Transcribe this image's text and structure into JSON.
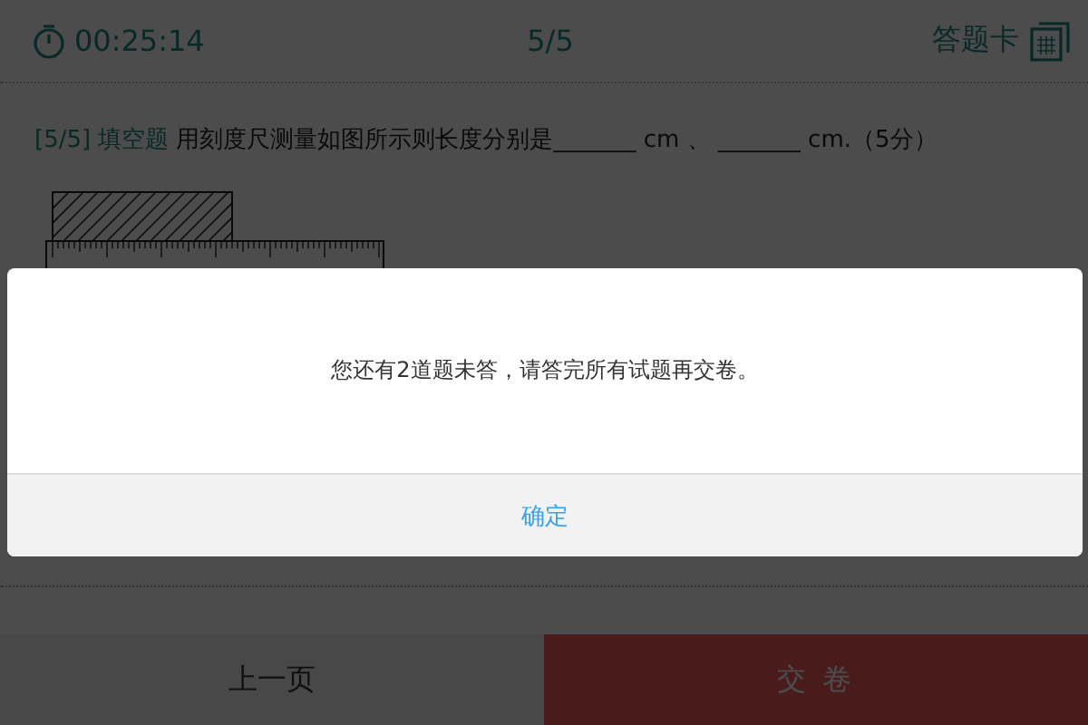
{
  "header": {
    "timer": "00:25:14",
    "progress": "5/5",
    "answer_card": "答题卡"
  },
  "question": {
    "number": "[5/5]",
    "type": "填空题",
    "text": "用刻度尺测量如图所示则长度分别是_______ cm 、 _______ cm.（5分）"
  },
  "dialog": {
    "message": "您还有2道题未答，请答完所有试题再交卷。",
    "button": "确定"
  },
  "footer_buttons": [
    {
      "label": "上一页",
      "kind": "secondary"
    },
    {
      "label": "交 卷",
      "kind": "primary"
    }
  ]
}
